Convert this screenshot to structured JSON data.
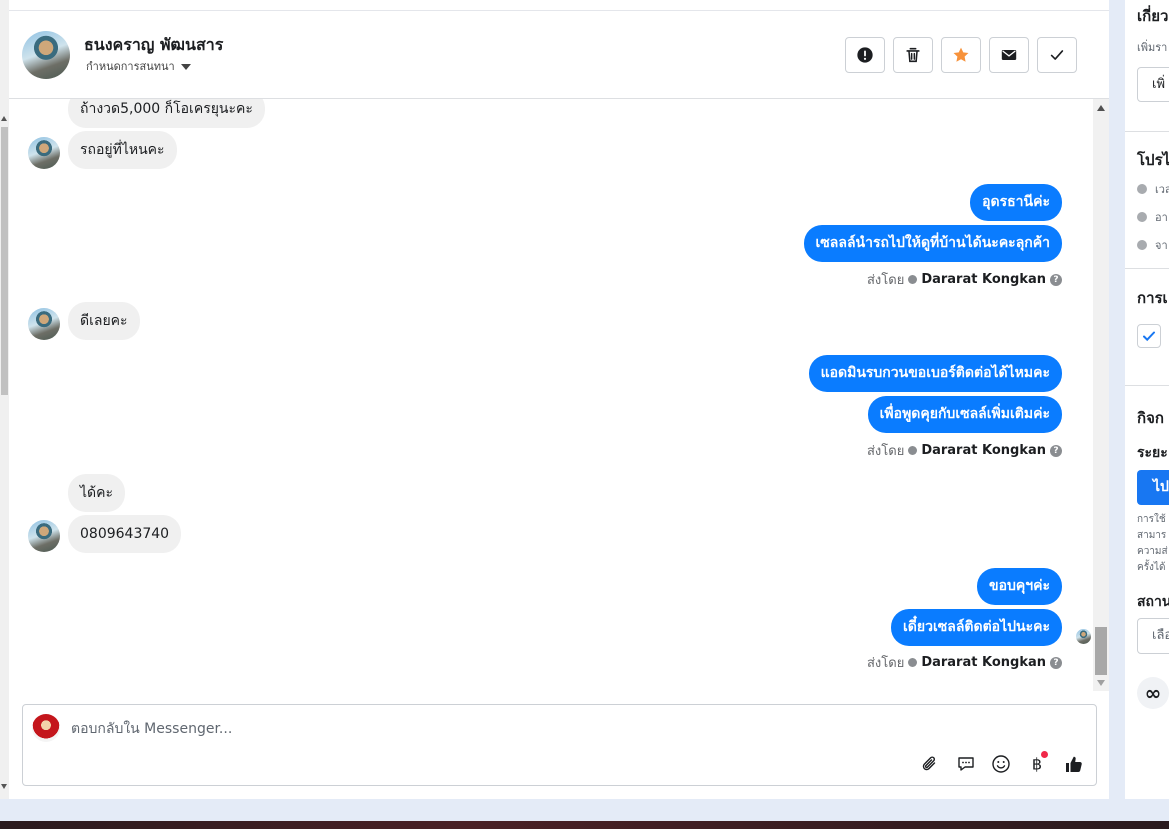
{
  "header": {
    "contact_name": "ธนงคราญ พัฒนสาร",
    "subtitle": "กำหนดการสนทนา",
    "actions": [
      {
        "name": "report-button",
        "icon": "exclamation-icon"
      },
      {
        "name": "delete-button",
        "icon": "trash-icon"
      },
      {
        "name": "star-button",
        "icon": "star-icon",
        "color": "#f7923b"
      },
      {
        "name": "mark-unread-button",
        "icon": "envelope-icon"
      },
      {
        "name": "done-button",
        "icon": "check-icon"
      }
    ]
  },
  "messages": {
    "in_1": "ถ้างวด5,000 ก็โอเครยุนะคะ",
    "in_2": "รถอยู่ที่ไหนคะ",
    "out_1": "อุดรธานีค่ะ",
    "out_2": "เซลลล์นำรถไปให้ดูที่บ้านได้นะคะลุกค้า",
    "in_3": "ดีเลยคะ",
    "out_3": "แอดมินรบกวนขอเบอร์ติดต่อได้ไหมคะ",
    "out_4": "เพื่อพูดคุยกับเซลล์เพิ่มเติมค่ะ",
    "in_4": "ได้คะ",
    "in_5": "0809643740",
    "out_5": "ขอบคุฯค่ะ",
    "out_6": "เดี๋ยวเซลล์ติดต่อไปนะคะ",
    "sent_by_label": "ส่งโดย",
    "sent_by_name": "Dararat Kongkan"
  },
  "composer": {
    "placeholder": "ตอบกลับใน Messenger...",
    "icons": [
      "paperclip-icon",
      "saved-reply-icon",
      "emoji-icon",
      "baht-icon",
      "thumbs-up-icon"
    ]
  },
  "right_panel": {
    "about_heading": "เกี่ยว",
    "about_sub": "เพิ่มรา",
    "about_button": "เพิ่",
    "profile_heading": "โปรไ",
    "profile_rows": [
      "เวล",
      "อา",
      "จา"
    ],
    "activity_heading": "การเ",
    "tasks_heading": "กิจก",
    "period_label": "ระยะ",
    "action_button": "ไป",
    "note_text": "การใช้\nสามาร\nความส่\nครั้งได้",
    "status_heading": "สถาน",
    "status_select": "เลือ",
    "meta_logo": "∞"
  },
  "colors": {
    "outgoing_bubble": "#0a7cff",
    "incoming_bubble": "#f0f0f0",
    "primary_button": "#1877f2",
    "star": "#f7923b",
    "notification_dot": "#f02849"
  }
}
